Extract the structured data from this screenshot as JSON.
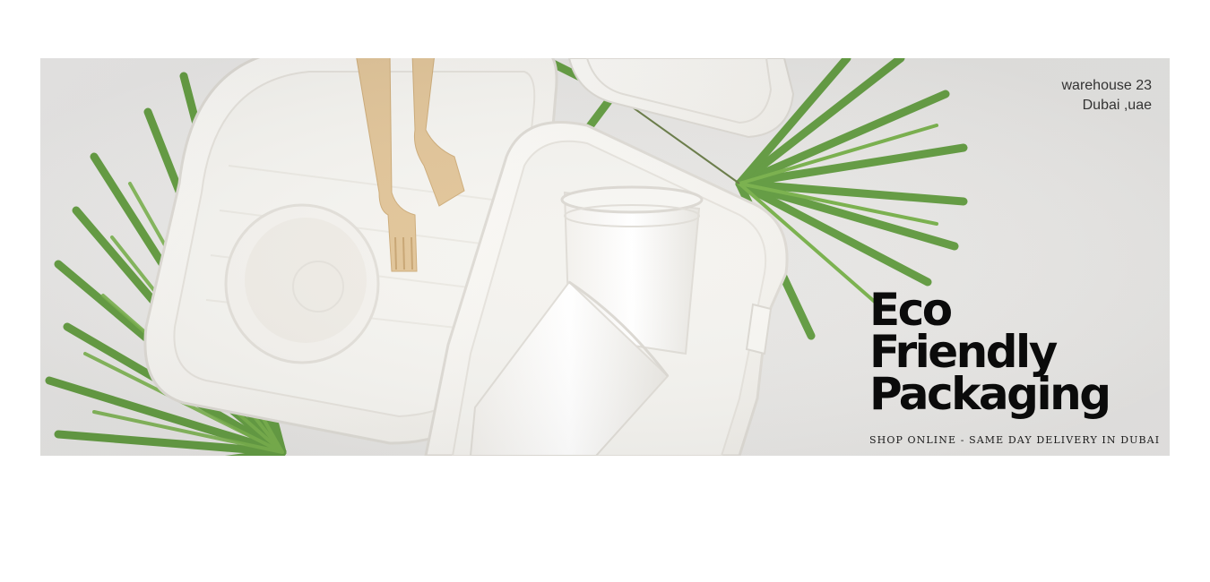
{
  "banner": {
    "address_line1": "warehouse 23",
    "address_line2": "Dubai ,uae",
    "headline_line1": "Eco",
    "headline_line2": "Friendly",
    "headline_line3": "Packaging",
    "tagline": "SHOP ONLINE - SAME DAY DELIVERY IN DUBAI"
  },
  "colors": {
    "background": "#ffffff",
    "surface": "#e9e8e6",
    "leaf_green": "#5f9a3c",
    "container_white": "#f8f7f4",
    "wood": "#e2c69b",
    "text": "#0b0b0b"
  }
}
